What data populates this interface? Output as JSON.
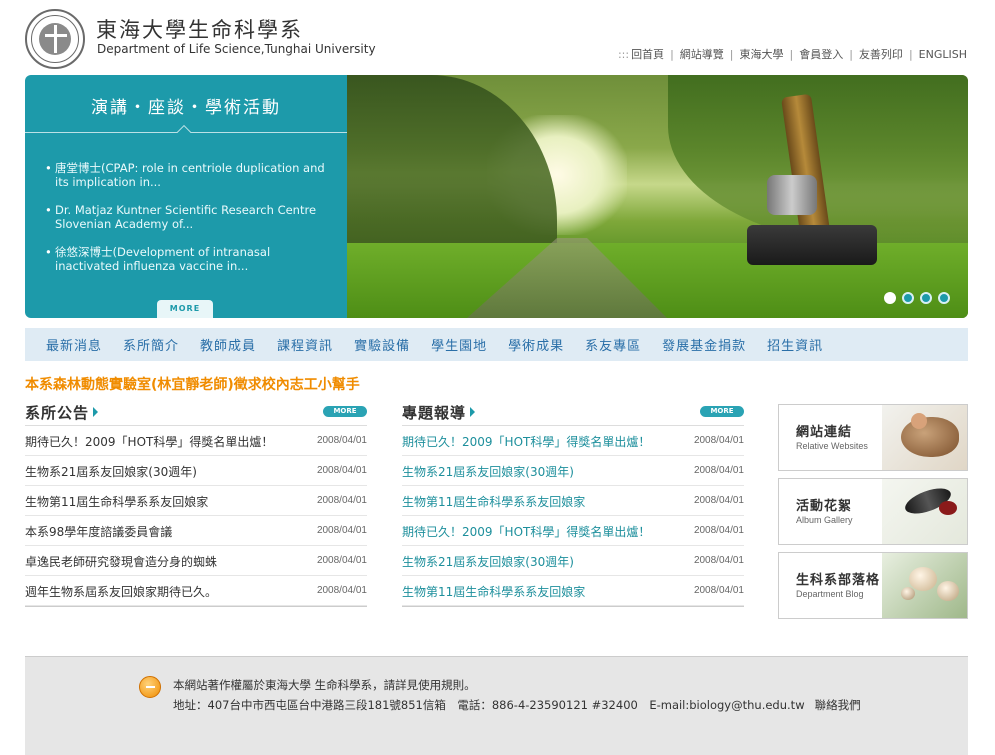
{
  "header": {
    "title_zh": "東海大學生命科學系",
    "title_en": "Department of Life Science,Tunghai University",
    "top_links_prefix": ":::",
    "top_links": [
      "回首頁",
      "網站導覽",
      "東海大學",
      "會員登入",
      "友善列印",
      "ENGLISH"
    ]
  },
  "banner": {
    "title": "演講・座談・學術活動",
    "events": [
      "唐堂博士(CPAP: role in centriole duplication and its implication in...",
      "Dr. Matjaz Kuntner Scientific Research Centre Slovenian Academy of...",
      "徐悠深博士(Development of intranasal inactivated influenza vaccine in..."
    ],
    "more_label": "MORE"
  },
  "nav": {
    "items": [
      "最新消息",
      "系所簡介",
      "教師成員",
      "課程資訊",
      "實驗設備",
      "學生園地",
      "學術成果",
      "系友專區",
      "發展基金捐款",
      "招生資訊"
    ]
  },
  "headline": "本系森林動態實驗室(林宜靜老師)徵求校內志工小幫手",
  "notices": {
    "title": "系所公告",
    "more_label": "MORE",
    "items": [
      {
        "title": "期待已久！2009「HOT科學」得獎名單出爐！",
        "date": "2008/04/01"
      },
      {
        "title": "生物系21屆系友回娘家(30週年)",
        "date": "2008/04/01"
      },
      {
        "title": "生物第11屆生命科學系系友回娘家",
        "date": "2008/04/01"
      },
      {
        "title": "本系98學年度諮議委員會議",
        "date": "2008/04/01"
      },
      {
        "title": "卓逸民老師研究發現會造分身的蜘蛛",
        "date": "2008/04/01"
      },
      {
        "title": "週年生物系屆系友回娘家期待已久。",
        "date": "2008/04/01"
      }
    ]
  },
  "features": {
    "title": "專題報導",
    "more_label": "MORE",
    "items": [
      {
        "title": "期待已久！2009「HOT科學」得獎名單出爐！",
        "date": "2008/04/01"
      },
      {
        "title": "生物系21屆系友回娘家(30週年)",
        "date": "2008/04/01"
      },
      {
        "title": "生物第11屆生命科學系系友回娘家",
        "date": "2008/04/01"
      },
      {
        "title": "期待已久！2009「HOT科學」得獎名單出爐！",
        "date": "2008/04/01"
      },
      {
        "title": "生物系21屆系友回娘家(30週年)",
        "date": "2008/04/01"
      },
      {
        "title": "生物第11屆生命科學系系友回娘家",
        "date": "2008/04/01"
      }
    ]
  },
  "side_links": [
    {
      "zh": "網站連結",
      "en": "Relative Websites"
    },
    {
      "zh": "活動花絮",
      "en": "Album Gallery"
    },
    {
      "zh": "生科系部落格",
      "en": "Department Blog"
    }
  ],
  "footer": {
    "line1": "本網站著作權屬於東海大學 生命科學系，請詳見使用規則。",
    "address": "地址：407台中市西屯區台中港路三段181號851信箱　電話：886-4-23590121 #32400　E-mail:biology@thu.edu.tw",
    "contact_label": "聯絡我們"
  },
  "colors": {
    "accent": "#1d9aaa",
    "nav_bg": "#dfebf4",
    "nav_text": "#2a6fa8",
    "headline": "#f08c00"
  }
}
